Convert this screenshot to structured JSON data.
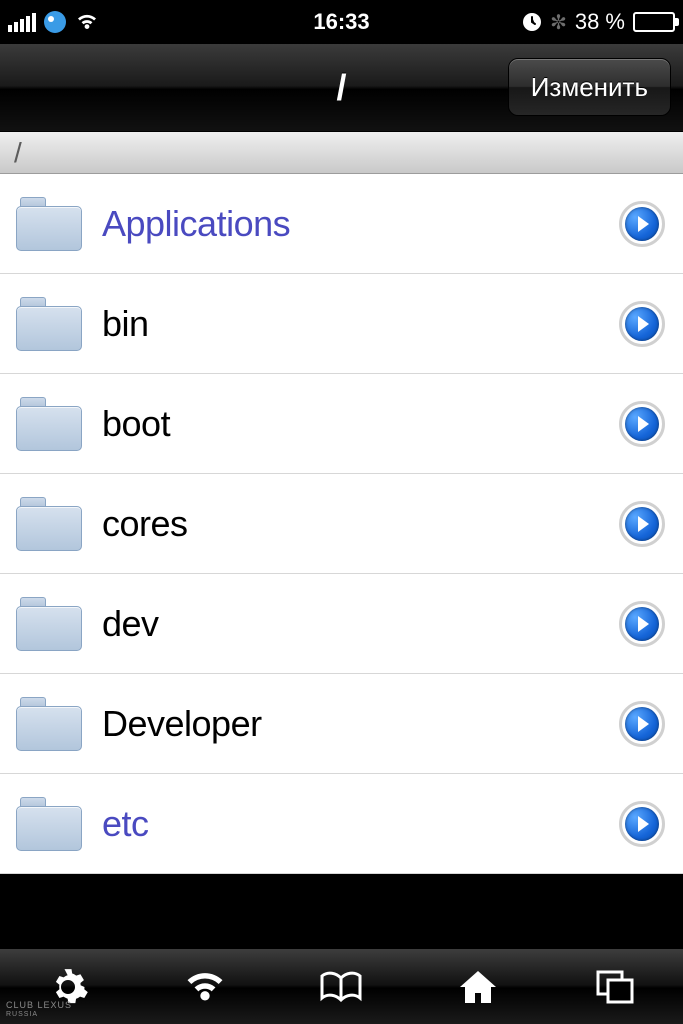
{
  "status": {
    "time": "16:33",
    "battery_pct": "38 %"
  },
  "nav": {
    "title": "/",
    "edit_label": "Изменить"
  },
  "path": {
    "current": "/"
  },
  "rows": [
    {
      "label": "Applications",
      "link": true
    },
    {
      "label": "bin",
      "link": false
    },
    {
      "label": "boot",
      "link": false
    },
    {
      "label": "cores",
      "link": false
    },
    {
      "label": "dev",
      "link": false
    },
    {
      "label": "Developer",
      "link": false
    },
    {
      "label": "etc",
      "link": true
    }
  ],
  "watermark": {
    "line1": "CLUB LEXUS",
    "line2": "RUSSIA"
  }
}
